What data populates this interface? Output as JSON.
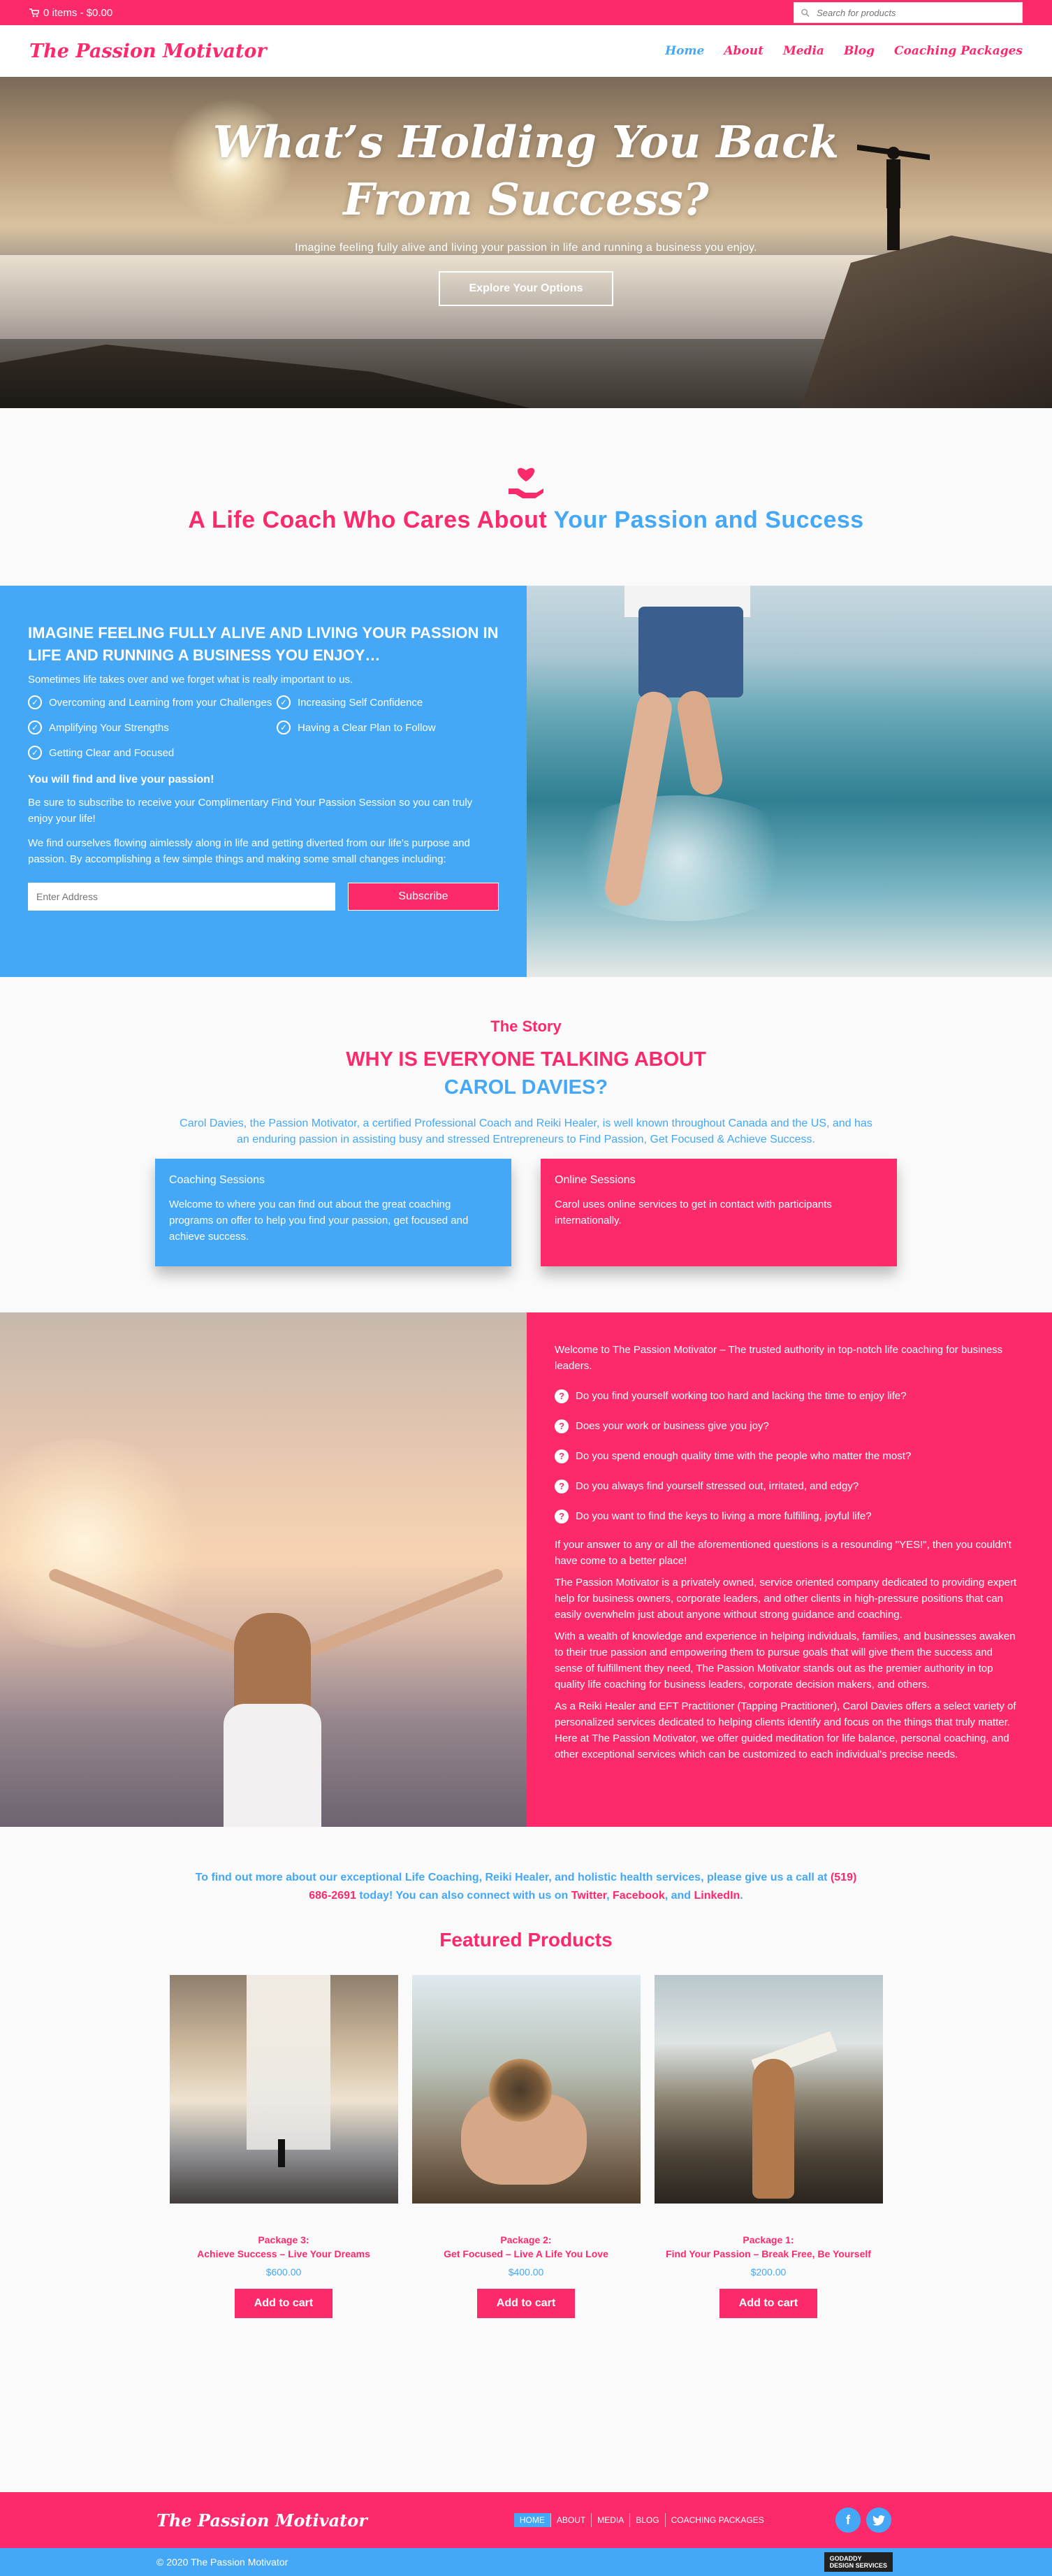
{
  "colors": {
    "pink": "#fd2a6b",
    "blue": "#44a8f7",
    "white": "#ffffff"
  },
  "topbar": {
    "cart_icon": "cart-icon",
    "cart_text": "0 items - $0.00",
    "search_placeholder": "Search for products",
    "search_icon": "search-icon"
  },
  "header": {
    "logo": "The Passion Motivator",
    "nav": [
      "Home",
      "About",
      "Media",
      "Blog",
      "Coaching Packages"
    ]
  },
  "hero": {
    "title_line1": "What’s Holding You Back",
    "title_line2": "From Success?",
    "subtitle": "Imagine feeling fully alive and living your passion in life and running a business you enjoy.",
    "cta": "Explore Your Options"
  },
  "tagline": {
    "icon": "heart-hand-icon",
    "part1": "A Life Coach Who Cares About ",
    "part2": "Your Passion and Success"
  },
  "imagine": {
    "heading": "IMAGINE FEELING FULLY ALIVE AND LIVING YOUR PASSION IN LIFE AND RUNNING A BUSINESS YOU ENJOY…",
    "intro": "Sometimes life takes over and we forget what is really important to us.",
    "checks": [
      "Overcoming and Learning from your Challenges",
      "Increasing Self Confidence",
      "Amplifying Your Strengths",
      "Having a Clear Plan to Follow",
      "Getting Clear and Focused"
    ],
    "bold": "You will find and live your passion!",
    "para1": "Be sure to subscribe to receive your Complimentary Find Your Passion Session so you can truly enjoy your life!",
    "para2": "We find ourselves flowing aimlessly along in life and getting diverted from our life's purpose and passion. By accomplishing a few simple things and making some small changes including:",
    "email_placeholder": "Enter Address",
    "subscribe": "Subscribe"
  },
  "story": {
    "kicker": "The Story",
    "heading_line1": "WHY IS EVERYONE TALKING ABOUT",
    "heading_line2": "CAROL DAVIES?",
    "description": "Carol Davies, the Passion Motivator, a certified Professional Coach and Reiki Healer, is well known throughout Canada and the US, and has an enduring passion in assisting busy and stressed Entrepreneurs to Find Passion, Get Focused & Achieve Success.",
    "cards": [
      {
        "title": "Coaching Sessions",
        "text": "Welcome to where you can find out about the great coaching programs on offer to help you find your passion, get focused and achieve success."
      },
      {
        "title": "Online Sessions",
        "text": "Carol uses online services to get in contact with participants internationally."
      }
    ]
  },
  "welcome": {
    "intro": "Welcome to The Passion Motivator – The trusted authority in top-notch life coaching for business leaders.",
    "questions": [
      "Do you find yourself working too hard and lacking the time to enjoy life?",
      "Does your work or business give you joy?",
      "Do you spend enough quality time with the people who matter the most?",
      "Do you always find yourself stressed out, irritated, and edgy?",
      "Do you want to find the keys to living a more fulfilling, joyful life?"
    ],
    "p1": "If your answer to any or all the aforementioned questions is a resounding \"YES!\", then you couldn't have come to a better place!",
    "p2": "The Passion Motivator is a privately owned, service oriented company dedicated to providing expert help for business owners, corporate leaders, and other clients in high-pressure positions that can easily overwhelm just about anyone without strong guidance and coaching.",
    "p3": "With a wealth of knowledge and experience in helping individuals, families, and businesses awaken to their true passion and empowering them to pursue goals that will give them the success and sense of fulfillment they need, The Passion Motivator stands out as the premier authority in top quality life coaching for business leaders, corporate decision makers, and others.",
    "p4": "As a Reiki Healer and EFT Practitioner (Tapping Practitioner), Carol Davies offers a select variety of personalized services dedicated to helping clients identify and focus on the things that truly matter. Here at The Passion Motivator, we offer guided meditation for life balance, personal coaching, and other exceptional services which can be customized to each individual's precise needs."
  },
  "contact": {
    "t1": "To find out more about our exceptional Life Coaching, Reiki Healer, and holistic health services, please give us a call at ",
    "phone": "(519) 686-2691",
    "t2": " today! You can also connect with us on ",
    "twitter": "Twitter",
    "sep1": ", ",
    "facebook": "Facebook",
    "sep2": ", and ",
    "linkedin": "LinkedIn",
    "end": "."
  },
  "products": {
    "heading": "Featured Products",
    "items": [
      {
        "line1": "Package 3:",
        "line2": "Achieve Success – Live Your Dreams",
        "price": "$600.00",
        "button": "Add to cart"
      },
      {
        "line1": "Package 2:",
        "line2": "Get Focused – Live A Life You Love",
        "price": "$400.00",
        "button": "Add to cart"
      },
      {
        "line1": "Package 1:",
        "line2": "Find Your Passion – Break Free, Be Yourself",
        "price": "$200.00",
        "button": "Add to cart"
      }
    ]
  },
  "footer": {
    "logo": "The Passion Motivator",
    "nav": [
      "HOME",
      "ABOUT",
      "MEDIA",
      "BLOG",
      "COACHING PACKAGES"
    ],
    "social": [
      "facebook-icon",
      "twitter-icon"
    ],
    "copyright": "© 2020 The Passion Motivator",
    "badge_line1": "GODADDY",
    "badge_line2": "DESIGN SERVICES"
  }
}
